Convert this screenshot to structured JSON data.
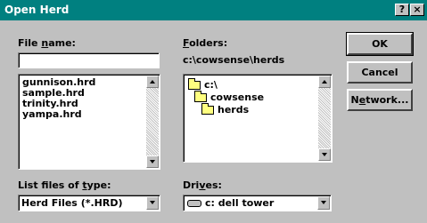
{
  "window": {
    "title": "Open Herd",
    "help_button": "?",
    "close_button": "×"
  },
  "file_name": {
    "label_prefix": "File ",
    "label_underlined": "n",
    "label_suffix": "ame:",
    "value": ""
  },
  "files": [
    "gunnison.hrd",
    "sample.hrd",
    "trinity.hrd",
    "yampa.hrd"
  ],
  "folders": {
    "label_underlined": "F",
    "label_suffix": "olders:",
    "current_path": "c:\\cowsense\\herds",
    "tree": [
      {
        "label": "c:\\",
        "icon": "open-folder-icon"
      },
      {
        "label": "cowsense",
        "icon": "open-folder-icon"
      },
      {
        "label": "herds",
        "icon": "open-folder-icon"
      }
    ]
  },
  "buttons": {
    "ok": "OK",
    "cancel": "Cancel",
    "network_prefix": "N",
    "network_underlined": "e",
    "network_suffix": "twork..."
  },
  "file_type": {
    "label_prefix": "List files of ",
    "label_underlined": "t",
    "label_suffix": "ype:",
    "selected": "Herd Files (*.HRD)"
  },
  "drives": {
    "label_prefix": "Dri",
    "label_underlined": "v",
    "label_suffix": "es:",
    "selected": "c: dell tower"
  }
}
